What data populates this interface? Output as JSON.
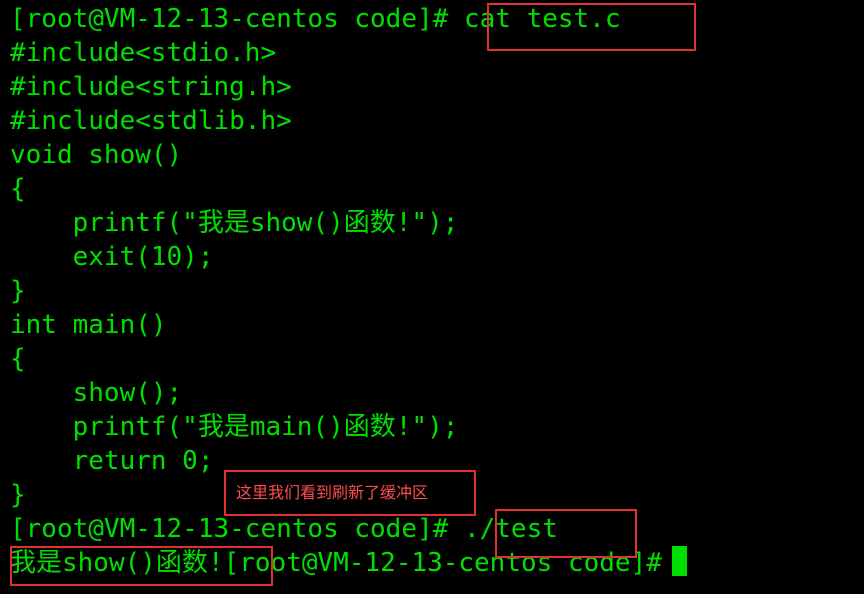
{
  "terminal": {
    "lines": {
      "0": {
        "prompt": "[root@VM-12-13-centos code]#",
        "command": " cat test.c"
      },
      "1": {
        "text": "#include<stdio.h>"
      },
      "2": {
        "text": "#include<string.h>"
      },
      "3": {
        "text": "#include<stdlib.h>"
      },
      "4": {
        "text": "void show()"
      },
      "5": {
        "text": "{"
      },
      "6": {
        "text": "    printf(\"我是show()函数!\");"
      },
      "7": {
        "text": "    exit(10);"
      },
      "8": {
        "text": "}"
      },
      "9": {
        "text": "int main()"
      },
      "10": {
        "text": "{"
      },
      "11": {
        "text": "    show();"
      },
      "12": {
        "text": "    printf(\"我是main()函数!\");"
      },
      "13": {
        "text": "    return 0;"
      },
      "14": {
        "text": "}"
      },
      "15": {
        "prompt": "[root@VM-12-13-centos code]#",
        "command": " ./test"
      },
      "16": {
        "output": "我是show()函数!",
        "prompt": "[root@VM-12-13-centos code]#"
      }
    },
    "text_color": "#00e000",
    "background": "#000000"
  },
  "annotation": {
    "note": "这里我们看到刷新了缓冲区",
    "box_color": "#e03030",
    "note_color": "#ff4d4d"
  }
}
